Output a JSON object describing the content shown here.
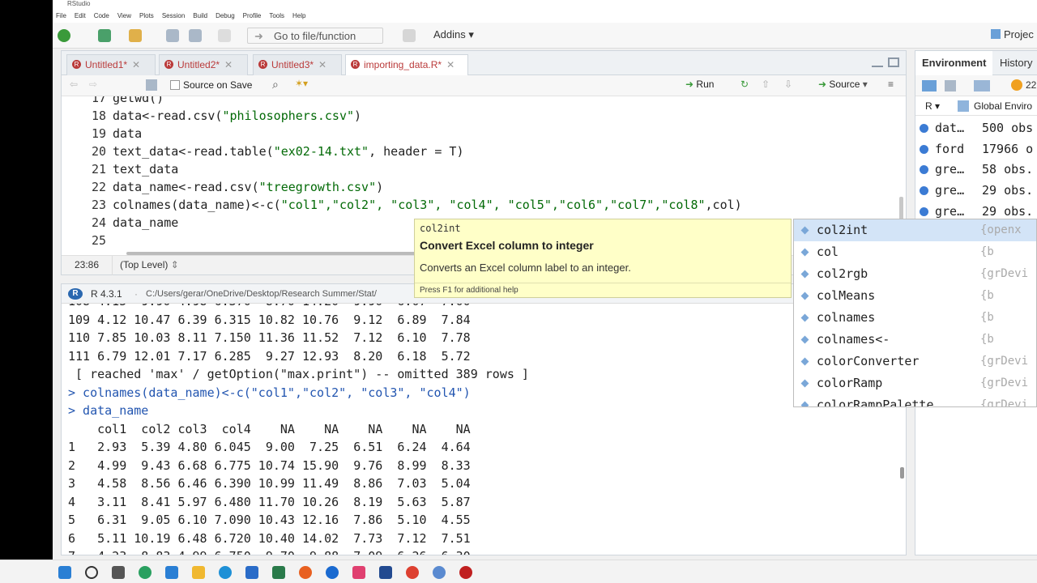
{
  "app": {
    "title": "RStudio"
  },
  "menu": [
    "File",
    "Edit",
    "Code",
    "View",
    "Plots",
    "Session",
    "Build",
    "Debug",
    "Profile",
    "Tools",
    "Help"
  ],
  "toolbar": {
    "goto_placeholder": "Go to file/function",
    "addins_label": "Addins",
    "project_label": "Projec"
  },
  "editor": {
    "tabs": [
      {
        "label": "Untitled1*"
      },
      {
        "label": "Untitled2*"
      },
      {
        "label": "Untitled3*"
      },
      {
        "label": "importing_data.R*"
      }
    ],
    "source_on_save": "Source on Save",
    "run_label": "Run",
    "source_label": "Source",
    "lines": [
      {
        "n": "17",
        "text": "getwd()"
      },
      {
        "n": "18",
        "pre": "data<-read.csv(",
        "s": "\"philosophers.csv\"",
        "post": ")"
      },
      {
        "n": "19",
        "text": "data"
      },
      {
        "n": "20",
        "pre": "text_data<-read.table(",
        "s": "\"ex02-14.txt\"",
        "post": ", header = T)"
      },
      {
        "n": "21",
        "text": "text_data"
      },
      {
        "n": "22",
        "pre": "data_name<-read.csv(",
        "s": "\"treegrowth.csv\"",
        "post": ")"
      },
      {
        "n": "23",
        "pre": "colnames(data_name)<-c(",
        "s": "\"col1\",\"col2\", \"col3\", \"col4\", \"col5\",\"col6\",\"col7\",\"col8\"",
        "post": ",col)"
      },
      {
        "n": "24",
        "text": "data_name"
      },
      {
        "n": "25",
        "text": ""
      }
    ],
    "cursor_pos": "23:86",
    "scope": "(Top Level)"
  },
  "console": {
    "version": "R 4.3.1",
    "path": "C:/Users/gerar/OneDrive/Desktop/Research Summer/Stat/",
    "lines": [
      "108 4.15  9.90 4.98 6.370  8.70 14.20  9.90  6.07  7.00",
      "109 4.12 10.47 6.39 6.315 10.82 10.76  9.12  6.89  7.84",
      "110 7.85 10.03 8.11 7.150 11.36 11.52  7.12  6.10  7.78",
      "111 6.79 12.01 7.17 6.285  9.27 12.93  8.20  6.18  5.72",
      " [ reached 'max' / getOption(\"max.print\") -- omitted 389 rows ]",
      "> colnames(data_name)<-c(\"col1\",\"col2\", \"col3\", \"col4\")",
      "> data_name",
      "    col1  col2 col3  col4    NA    NA    NA    NA    NA",
      "1   2.93  5.39 4.80 6.045  9.00  7.25  6.51  6.24  4.64",
      "2   4.99  9.43 6.68 6.775 10.74 15.90  9.76  8.99  8.33",
      "3   4.58  8.56 6.46 6.390 10.99 11.49  8.86  7.03  5.04",
      "4   3.11  8.41 5.97 6.480 11.70 10.26  8.19  5.63  5.87",
      "5   6.31  9.05 6.10 7.090 10.43 12.16  7.86  5.10  4.55",
      "6   5.11 10.19 6.48 6.720 10.40 14.02  7.73  7.12  7.51",
      "7   4.23  8.83 4.99 6.750  9.70  9.88  7.09  6.26  6.30"
    ]
  },
  "environment": {
    "tabs": [
      "Environment",
      "History"
    ],
    "lang": "R",
    "scope": "Global Enviro",
    "mem": "22",
    "rows": [
      {
        "name": "dat…",
        "value": "500 obs"
      },
      {
        "name": "ford",
        "value": "17966 o"
      },
      {
        "name": "gre…",
        "value": "58 obs."
      },
      {
        "name": "gre…",
        "value": "29 obs."
      },
      {
        "name": "gre…",
        "value": "29 obs."
      }
    ]
  },
  "tooltip": {
    "fn": "col2int",
    "title": "Convert Excel column to integer",
    "desc": "Converts an Excel column label to an integer.",
    "hint": "Press F1 for additional help"
  },
  "completion": [
    {
      "name": "col2int",
      "pkg": "{openx"
    },
    {
      "name": "col",
      "pkg": "{b"
    },
    {
      "name": "col2rgb",
      "pkg": "{grDevi"
    },
    {
      "name": "colMeans",
      "pkg": "{b"
    },
    {
      "name": "colnames",
      "pkg": "{b"
    },
    {
      "name": "colnames<-",
      "pkg": "{b"
    },
    {
      "name": "colorConverter",
      "pkg": "{grDevi"
    },
    {
      "name": "colorRamp",
      "pkg": "{grDevi"
    },
    {
      "name": "colorRampPalette",
      "pkg": "{grDevi"
    }
  ]
}
